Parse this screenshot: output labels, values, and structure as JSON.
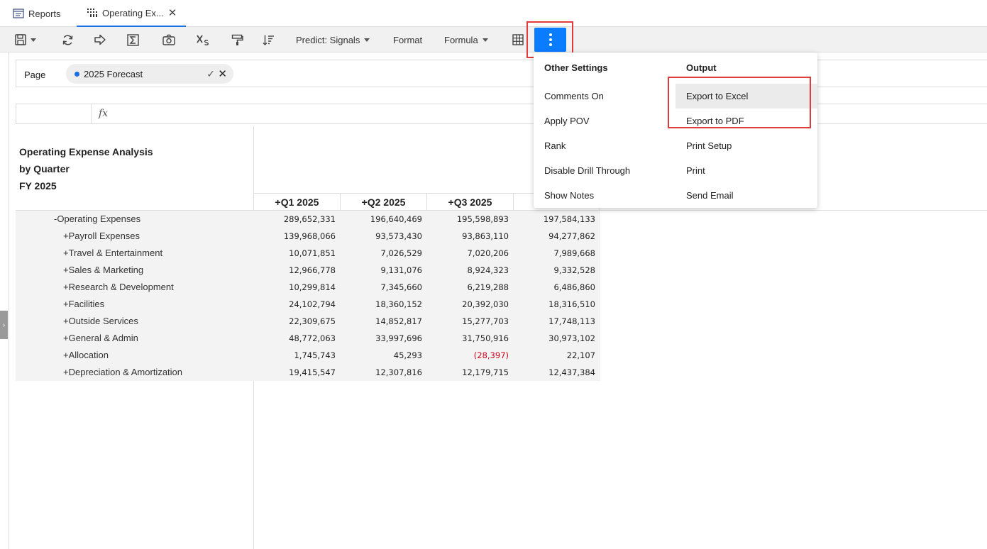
{
  "tabs": [
    {
      "label": "Reports"
    },
    {
      "label": "Operating Ex...",
      "close": "✕"
    }
  ],
  "toolbar": {
    "predict_label": "Predict: Signals",
    "format_label": "Format",
    "formula_label": "Formula"
  },
  "pov": {
    "label": "Page",
    "chip_value": "2025 Forecast",
    "accent": "#1a6fe0"
  },
  "formula_bar": {
    "fx_symbol": "fx"
  },
  "report": {
    "title_line1": "Operating Expense Analysis",
    "title_line2": "by Quarter",
    "title_line3": "FY 2025",
    "columns": [
      "+Q1 2025",
      "+Q2 2025",
      "+Q3 2025",
      ""
    ],
    "rows": [
      {
        "label": "-Operating Expenses",
        "values": [
          "289,652,331",
          "196,640,469",
          "195,598,893",
          "197,584,133"
        ]
      },
      {
        "label": "+Payroll Expenses",
        "values": [
          "139,968,066",
          "93,573,430",
          "93,863,110",
          "94,277,862"
        ]
      },
      {
        "label": "+Travel & Entertainment",
        "values": [
          "10,071,851",
          "7,026,529",
          "7,020,206",
          "7,989,668"
        ]
      },
      {
        "label": "+Sales & Marketing",
        "values": [
          "12,966,778",
          "9,131,076",
          "8,924,323",
          "9,332,528"
        ]
      },
      {
        "label": "+Research & Development",
        "values": [
          "10,299,814",
          "7,345,660",
          "6,219,288",
          "6,486,860"
        ]
      },
      {
        "label": "+Facilities",
        "values": [
          "24,102,794",
          "18,360,152",
          "20,392,030",
          "18,316,510"
        ]
      },
      {
        "label": "+Outside Services",
        "values": [
          "22,309,675",
          "14,852,817",
          "15,277,703",
          "17,748,113"
        ]
      },
      {
        "label": "+General & Admin",
        "values": [
          "48,772,063",
          "33,997,696",
          "31,750,916",
          "30,973,102"
        ]
      },
      {
        "label": "+Allocation",
        "values": [
          "1,745,743",
          "45,293",
          "(28,397)",
          "22,107"
        ]
      },
      {
        "label": "+Depreciation & Amortization",
        "values": [
          "19,415,547",
          "12,307,816",
          "12,179,715",
          "12,437,384"
        ]
      }
    ]
  },
  "menu": {
    "other_settings": {
      "heading": "Other Settings",
      "items": [
        "Comments On",
        "Apply POV",
        "Rank",
        "Disable Drill Through",
        "Show Notes"
      ]
    },
    "output": {
      "heading": "Output",
      "items": [
        "Export to Excel",
        "Export to PDF",
        "Print Setup",
        "Print",
        "Send Email"
      ]
    }
  },
  "colors": {
    "primary_button": "#0a7cff",
    "highlight_box": "#e03c3c",
    "negative_value": "#d0021b"
  }
}
